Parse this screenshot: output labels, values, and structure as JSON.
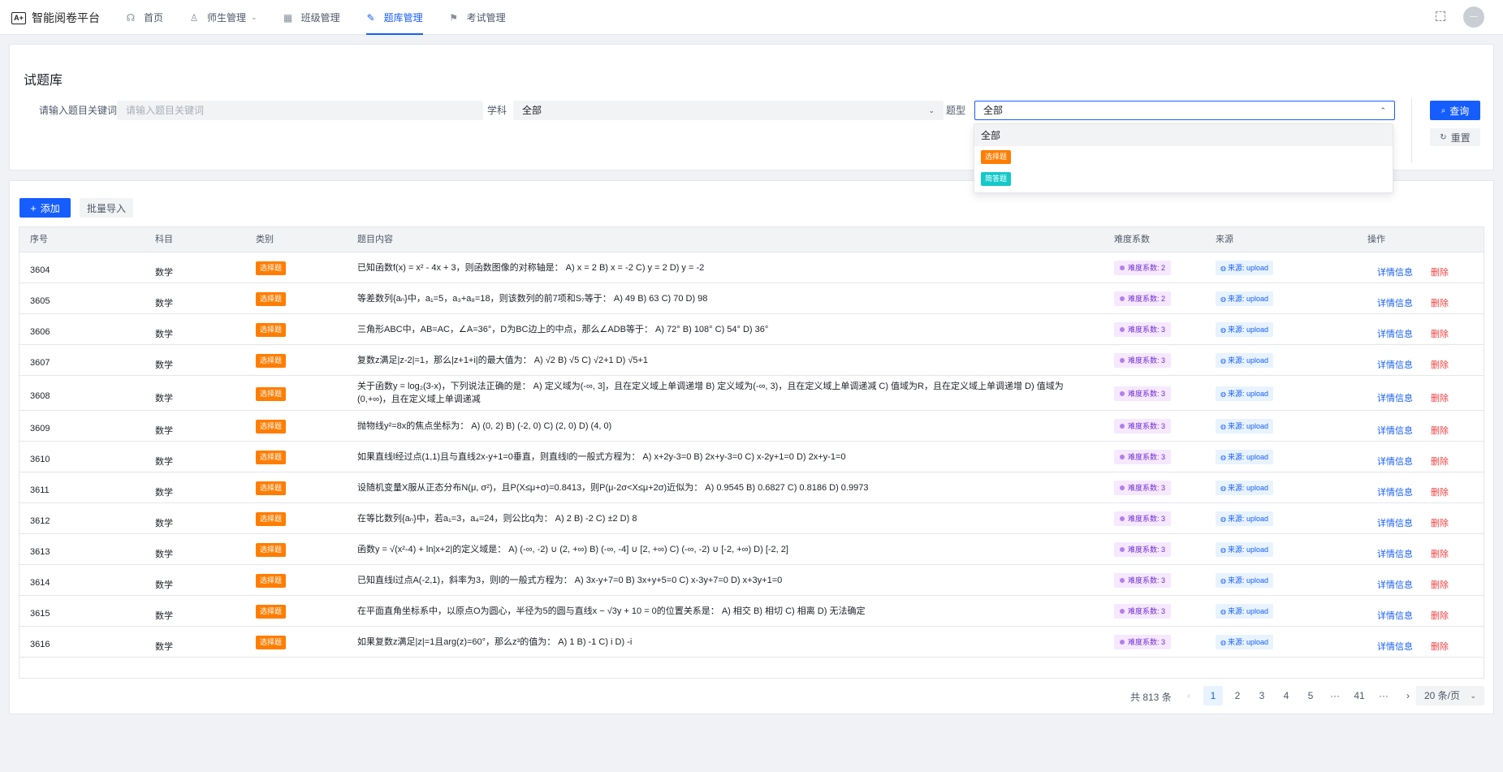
{
  "app": {
    "logo_mark": "A+",
    "title": "智能阅卷平台"
  },
  "nav": [
    {
      "label": "首页",
      "icon": "☊",
      "name": "nav-home"
    },
    {
      "label": "师生管理",
      "icon": "♙",
      "name": "nav-people",
      "has_dropdown": true
    },
    {
      "label": "班级管理",
      "icon": "▦",
      "name": "nav-class"
    },
    {
      "label": "题库管理",
      "icon": "✎",
      "name": "nav-question-bank",
      "active": true
    },
    {
      "label": "考试管理",
      "icon": "⚑",
      "name": "nav-exam"
    }
  ],
  "avatar": {
    "text": "—"
  },
  "search": {
    "title": "试题库",
    "keyword_label": "请输入题目关键词",
    "keyword_placeholder": "请输入题目关键词",
    "subject_label": "学科",
    "subject_value": "全部",
    "type_label": "题型",
    "type_value": "全部",
    "query_label": "查询",
    "reset_label": "重置"
  },
  "type_dropdown": {
    "options": [
      {
        "label": "全部",
        "kind": "text"
      },
      {
        "label": "选择题",
        "kind": "tag-orange"
      },
      {
        "label": "简答题",
        "kind": "tag-cyan"
      }
    ]
  },
  "toolbar": {
    "add_label": "添加",
    "import_label": "批量导入"
  },
  "table": {
    "headers": [
      "序号",
      "科目",
      "类别",
      "题目内容",
      "难度系数",
      "来源",
      "操作"
    ],
    "rows": [
      {
        "id": "3604",
        "subject": "数学",
        "type": "选择题",
        "content": "已知函数f(x) = x² - 4x + 3，则函数图像的对称轴是： A) x = 2 B) x = -2 C) y = 2 D) y = -2",
        "difficulty": "难度系数: 2",
        "source": "来源: upload"
      },
      {
        "id": "3605",
        "subject": "数学",
        "type": "选择题",
        "content": "等差数列{aₙ}中，a₁=5，a₃+a₈=18，则该数列的前7项和S₇等于： A) 49 B) 63 C) 70 D) 98",
        "difficulty": "难度系数: 2",
        "source": "来源: upload"
      },
      {
        "id": "3606",
        "subject": "数学",
        "type": "选择题",
        "content": "三角形ABC中，AB=AC，∠A=36°，D为BC边上的中点，那么∠ADB等于： A) 72° B) 108° C) 54° D) 36°",
        "difficulty": "难度系数: 3",
        "source": "来源: upload"
      },
      {
        "id": "3607",
        "subject": "数学",
        "type": "选择题",
        "content": "复数z满足|z-2|=1，那么|z+1+i|的最大值为： A) √2 B) √5 C) √2+1 D) √5+1",
        "difficulty": "难度系数: 3",
        "source": "来源: upload"
      },
      {
        "id": "3608",
        "subject": "数学",
        "type": "选择题",
        "content": "关于函数y = log₂(3-x)，下列说法正确的是： A) 定义域为(-∞, 3]，且在定义域上单调递增 B) 定义域为(-∞, 3)，且在定义域上单调递减 C) 值域为R，且在定义域上单调递增 D) 值域为(0,+∞)，且在定义域上单调递减",
        "difficulty": "难度系数: 3",
        "source": "来源: upload",
        "tall": true
      },
      {
        "id": "3609",
        "subject": "数学",
        "type": "选择题",
        "content": "抛物线y²=8x的焦点坐标为： A) (0, 2) B) (-2, 0) C) (2, 0) D) (4, 0)",
        "difficulty": "难度系数: 3",
        "source": "来源: upload"
      },
      {
        "id": "3610",
        "subject": "数学",
        "type": "选择题",
        "content": "如果直线l经过点(1,1)且与直线2x-y+1=0垂直，则直线l的一般式方程为： A) x+2y-3=0 B) 2x+y-3=0 C) x-2y+1=0 D) 2x+y-1=0",
        "difficulty": "难度系数: 3",
        "source": "来源: upload"
      },
      {
        "id": "3611",
        "subject": "数学",
        "type": "选择题",
        "content": "设随机变量X服从正态分布N(μ, σ²)，且P(X≤μ+σ)=0.8413，则P(μ-2σ<X≤μ+2σ)近似为： A) 0.9545 B) 0.6827 C) 0.8186 D) 0.9973",
        "difficulty": "难度系数: 3",
        "source": "来源: upload"
      },
      {
        "id": "3612",
        "subject": "数学",
        "type": "选择题",
        "content": "在等比数列{aₙ}中，若a₁=3，a₄=24，则公比q为： A) 2 B) -2 C) ±2 D) 8",
        "difficulty": "难度系数: 3",
        "source": "来源: upload"
      },
      {
        "id": "3613",
        "subject": "数学",
        "type": "选择题",
        "content": "函数y = √(x²-4) + ln|x+2|的定义域是： A) (-∞, -2) ∪ (2, +∞) B) (-∞, -4] ∪ [2, +∞) C) (-∞, -2) ∪ [-2, +∞) D) [-2, 2]",
        "difficulty": "难度系数: 3",
        "source": "来源: upload"
      },
      {
        "id": "3614",
        "subject": "数学",
        "type": "选择题",
        "content": "已知直线l过点A(-2,1)，斜率为3，则l的一般式方程为： A) 3x-y+7=0 B) 3x+y+5=0 C) x-3y+7=0 D) x+3y+1=0",
        "difficulty": "难度系数: 3",
        "source": "来源: upload"
      },
      {
        "id": "3615",
        "subject": "数学",
        "type": "选择题",
        "content": "在平面直角坐标系中，以原点O为圆心，半径为5的圆与直线x − √3y + 10 = 0的位置关系是： A) 相交 B) 相切 C) 相离 D) 无法确定",
        "difficulty": "难度系数: 3",
        "source": "来源: upload"
      },
      {
        "id": "3616",
        "subject": "数学",
        "type": "选择题",
        "content": "如果复数z满足|z|=1且arg(z)=60°，那么z³的值为： A) 1 B) -1 C) i D) -i",
        "difficulty": "难度系数: 3",
        "source": "来源: upload"
      }
    ],
    "detail_label": "详情信息",
    "delete_label": "删除"
  },
  "pagination": {
    "total": "共 813 条",
    "prev": "‹",
    "pages": [
      "1",
      "2",
      "3",
      "4",
      "5",
      "···",
      "41",
      "···"
    ],
    "current": "1",
    "next": "›",
    "page_size": "20 条/页"
  },
  "colors": {
    "primary": "#165dff",
    "tag_orange": "#ff7d00",
    "tag_cyan": "#14c9c9",
    "danger": "#f53f3f"
  }
}
